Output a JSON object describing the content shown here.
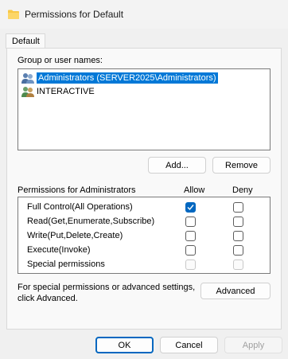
{
  "window": {
    "title": "Permissions for Default",
    "icon": "folder-icon"
  },
  "tabs": [
    {
      "label": "Default",
      "selected": true
    }
  ],
  "users_section": {
    "label": "Group or user names:",
    "items": [
      {
        "label": "Administrators (SERVER2025\\Administrators)",
        "selected": true,
        "icon": "group-icon"
      },
      {
        "label": "INTERACTIVE",
        "selected": false,
        "icon": "group-icon"
      }
    ]
  },
  "buttons": {
    "add": "Add...",
    "remove": "Remove",
    "advanced": "Advanced",
    "ok": "OK",
    "cancel": "Cancel",
    "apply": "Apply"
  },
  "permissions": {
    "label": "Permissions for Administrators",
    "allow_header": "Allow",
    "deny_header": "Deny",
    "rows": [
      {
        "name": "Full Control(All Operations)",
        "allow": true,
        "deny": false,
        "enabled": true
      },
      {
        "name": "Read(Get,Enumerate,Subscribe)",
        "allow": false,
        "deny": false,
        "enabled": true
      },
      {
        "name": "Write(Put,Delete,Create)",
        "allow": false,
        "deny": false,
        "enabled": true
      },
      {
        "name": "Execute(Invoke)",
        "allow": false,
        "deny": false,
        "enabled": true
      },
      {
        "name": "Special permissions",
        "allow": false,
        "deny": false,
        "enabled": false
      }
    ]
  },
  "advanced_note": {
    "line1": "For special permissions or advanced settings,",
    "line2": "click Advanced."
  },
  "colors": {
    "accent": "#0067c0",
    "selection": "#0078d7",
    "folder": "#f8c847"
  }
}
